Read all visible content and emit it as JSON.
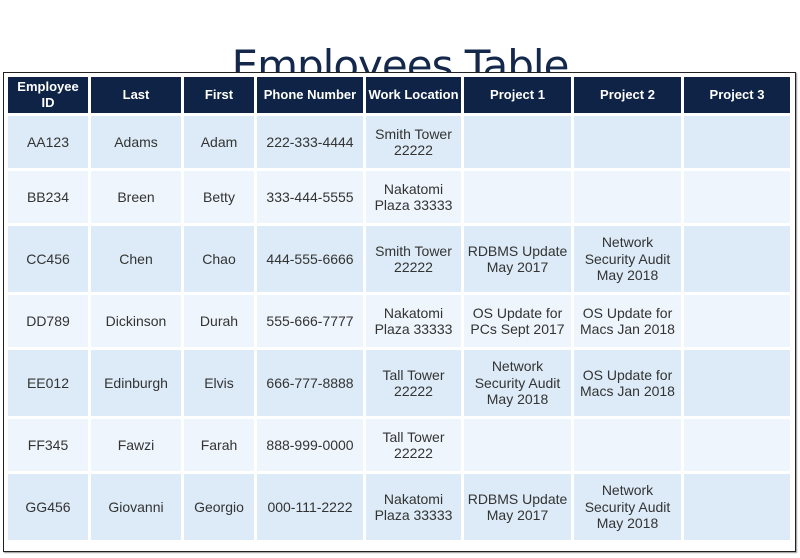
{
  "title": "Employees Table",
  "colors": {
    "header_bg": "#0e2345",
    "title": "#14284b",
    "row_odd": "#dcebf7",
    "row_even": "#eef5fc"
  },
  "columns": [
    "Employee ID",
    "Last",
    "First",
    "Phone Number",
    "Work Location",
    "Project 1",
    "Project 2",
    "Project 3"
  ],
  "rows": [
    [
      "AA123",
      "Adams",
      "Adam",
      "222-333-4444",
      "Smith Tower 22222",
      "",
      "",
      ""
    ],
    [
      "BB234",
      "Breen",
      "Betty",
      "333-444-5555",
      "Nakatomi Plaza 33333",
      "",
      "",
      ""
    ],
    [
      "CC456",
      "Chen",
      "Chao",
      "444-555-6666",
      "Smith Tower 22222",
      "RDBMS Update May 2017",
      "Network Security Audit May 2018",
      ""
    ],
    [
      "DD789",
      "Dickinson",
      "Durah",
      "555-666-7777",
      "Nakatomi Plaza 33333",
      "OS Update for PCs Sept 2017",
      "OS Update for Macs Jan 2018",
      ""
    ],
    [
      "EE012",
      "Edinburgh",
      "Elvis",
      "666-777-8888",
      "Tall Tower 22222",
      "Network Security Audit May 2018",
      "OS Update for Macs Jan 2018",
      ""
    ],
    [
      "FF345",
      "Fawzi",
      "Farah",
      "888-999-0000",
      "Tall Tower 22222",
      "",
      "",
      ""
    ],
    [
      "GG456",
      "Giovanni",
      "Georgio",
      "000-111-2222",
      "Nakatomi Plaza 33333",
      "RDBMS Update May 2017",
      "Network Security Audit May 2018",
      ""
    ]
  ]
}
